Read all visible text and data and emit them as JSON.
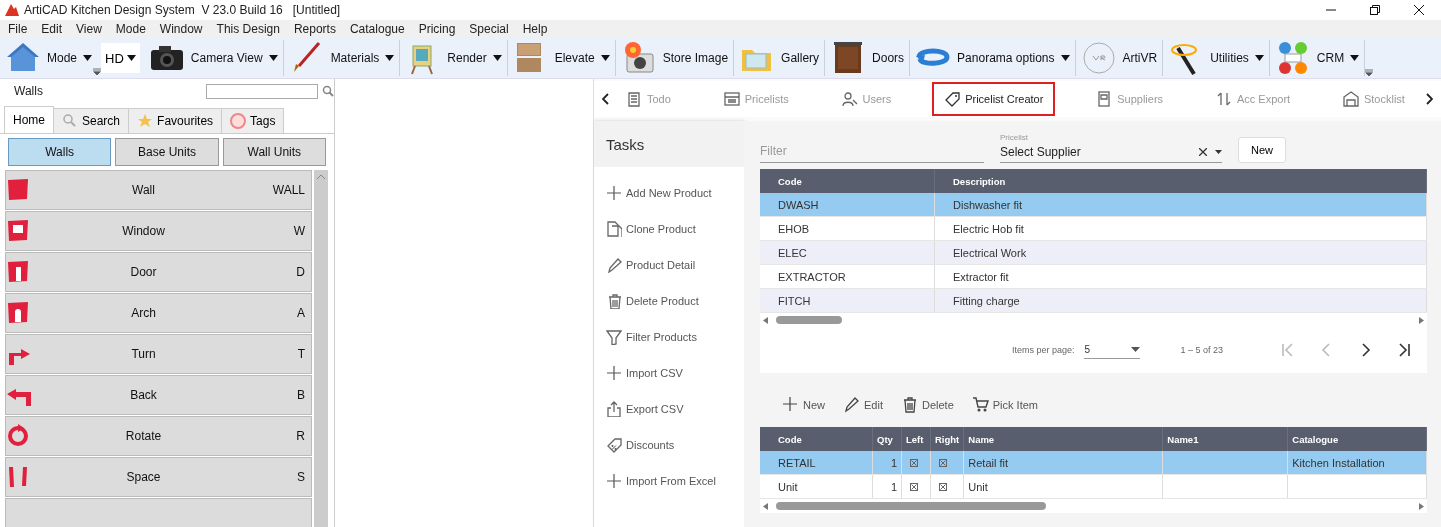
{
  "window": {
    "title": "ArtiCAD Kitchen Design System  V 23.0 Build 16   [Untitled]"
  },
  "menu": [
    "File",
    "Edit",
    "View",
    "Mode",
    "Window",
    "This Design",
    "Reports",
    "Catalogue",
    "Pricing",
    "Special",
    "Help"
  ],
  "toolbar": [
    {
      "label": "Mode",
      "kind": "dropdown"
    },
    {
      "label": "HD",
      "kind": "select"
    },
    {
      "label": "Camera View",
      "kind": "dropdown"
    },
    {
      "label": "Materials",
      "kind": "dropdown"
    },
    {
      "label": "Render",
      "kind": "dropdown"
    },
    {
      "label": "Elevate",
      "kind": "dropdown"
    },
    {
      "label": "Store Image",
      "kind": "button"
    },
    {
      "label": "Gallery",
      "kind": "button"
    },
    {
      "label": "Doors",
      "kind": "button"
    },
    {
      "label": "Panorama options",
      "kind": "dropdown"
    },
    {
      "label": "ArtiVR",
      "kind": "button"
    },
    {
      "label": "Utilities",
      "kind": "dropdown"
    },
    {
      "label": "CRM",
      "kind": "dropdown"
    }
  ],
  "walls_panel": {
    "title": "Walls",
    "tabs": [
      {
        "label": "Home",
        "selected": true
      },
      {
        "label": "Search",
        "selected": false
      },
      {
        "label": "Favourites",
        "selected": false
      },
      {
        "label": "Tags",
        "selected": false
      }
    ],
    "categories": [
      {
        "label": "Walls",
        "selected": true
      },
      {
        "label": "Base Units",
        "selected": false
      },
      {
        "label": "Wall Units",
        "selected": false
      }
    ],
    "items": [
      {
        "name": "Wall",
        "shortcut": "WALL"
      },
      {
        "name": "Window",
        "shortcut": "W"
      },
      {
        "name": "Door",
        "shortcut": "D"
      },
      {
        "name": "Arch",
        "shortcut": "A"
      },
      {
        "name": "Turn",
        "shortcut": "T"
      },
      {
        "name": "Back",
        "shortcut": "B"
      },
      {
        "name": "Rotate",
        "shortcut": "R"
      },
      {
        "name": "Space",
        "shortcut": "S"
      }
    ]
  },
  "nav_tabs": [
    {
      "label": "Todo",
      "selected": false,
      "highlighted": false
    },
    {
      "label": "Pricelists",
      "selected": false,
      "highlighted": false
    },
    {
      "label": "Users",
      "selected": false,
      "highlighted": false
    },
    {
      "label": "Pricelist Creator",
      "selected": true,
      "highlighted": true
    },
    {
      "label": "Suppliers",
      "selected": false,
      "highlighted": false
    },
    {
      "label": "Acc Export",
      "selected": false,
      "highlighted": false
    },
    {
      "label": "Stocklist",
      "selected": false,
      "highlighted": false
    }
  ],
  "tasks": {
    "title": "Tasks",
    "items": [
      "Add New Product",
      "Clone Product",
      "Product Detail",
      "Delete Product",
      "Filter Products",
      "Import CSV",
      "Export CSV",
      "Discounts",
      "Import From Excel"
    ]
  },
  "filter": {
    "placeholder": "Filter"
  },
  "pricelist_field": {
    "label": "Pricelist",
    "value": "Select Supplier"
  },
  "new_button": "New",
  "products_table": {
    "columns": [
      "Code",
      "Description"
    ],
    "rows": [
      {
        "cells": [
          "DWASH",
          "Dishwasher fit"
        ],
        "selected": true
      },
      {
        "cells": [
          "EHOB",
          "Electric Hob fit"
        ],
        "selected": false
      },
      {
        "cells": [
          "ELEC",
          "Electrical Work"
        ],
        "selected": false
      },
      {
        "cells": [
          "EXTRACTOR",
          "Extractor fit"
        ],
        "selected": false
      },
      {
        "cells": [
          "FITCH",
          "Fitting charge"
        ],
        "selected": false
      }
    ]
  },
  "pagination": {
    "label": "Items per page:",
    "page_size": "5",
    "range": "1 – 5 of 23"
  },
  "item_actions": [
    "New",
    "Edit",
    "Delete",
    "Pick Item"
  ],
  "items_table": {
    "columns": [
      "Code",
      "Qty",
      "Left",
      "Right",
      "Name",
      "Name1",
      "Catalogue"
    ],
    "rows": [
      {
        "code": "RETAIL",
        "qty": "1",
        "left": true,
        "right": true,
        "name": "Retail fit",
        "name1": "",
        "catalogue": "Kitchen Installation",
        "selected": true
      },
      {
        "code": "Unit",
        "qty": "1",
        "left": true,
        "right": true,
        "name": "Unit",
        "name1": "",
        "catalogue": "",
        "selected": false
      }
    ]
  }
}
